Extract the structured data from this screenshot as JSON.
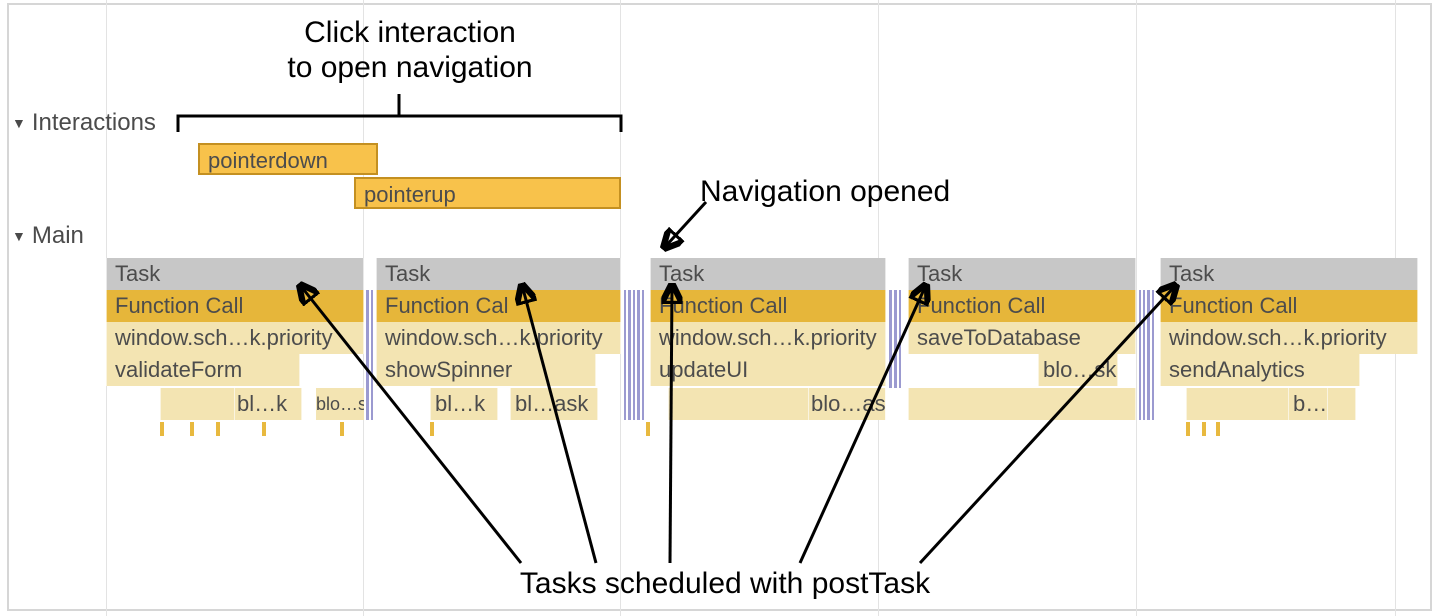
{
  "annotations": {
    "click_interaction_line1": "Click interaction",
    "click_interaction_line2": "to open navigation",
    "nav_opened": "Navigation opened",
    "tasks_scheduled": "Tasks scheduled with postTask"
  },
  "tracks": {
    "interactions": {
      "label": "Interactions",
      "events": [
        {
          "name": "pointerdown"
        },
        {
          "name": "pointerup"
        }
      ]
    },
    "main": {
      "label": "Main",
      "tasks": [
        {
          "task": "Task",
          "func": "Function Call",
          "sched": "window.sch…k.priority",
          "leaf": "validateForm",
          "subleaves": [
            "bl…k",
            "blo…sk"
          ]
        },
        {
          "task": "Task",
          "func": "Function Cal",
          "sched": "window.sch…k.priority",
          "leaf": "showSpinner",
          "subleaves": [
            "bl…k",
            "bl…ask"
          ]
        },
        {
          "task": "Task",
          "func": "Function Call",
          "sched": "window.sch…k.priority",
          "leaf": "updateUI",
          "subleaves": [
            "blo…ask"
          ]
        },
        {
          "task": "Task",
          "func": "Function Call",
          "sched": "saveToDatabase",
          "leaf": "blo…sk",
          "subleaves": []
        },
        {
          "task": "Task",
          "func": "Function Call",
          "sched": "window.sch…k.priority",
          "leaf": "sendAnalytics",
          "subleaves": [
            "b…"
          ]
        }
      ]
    }
  }
}
